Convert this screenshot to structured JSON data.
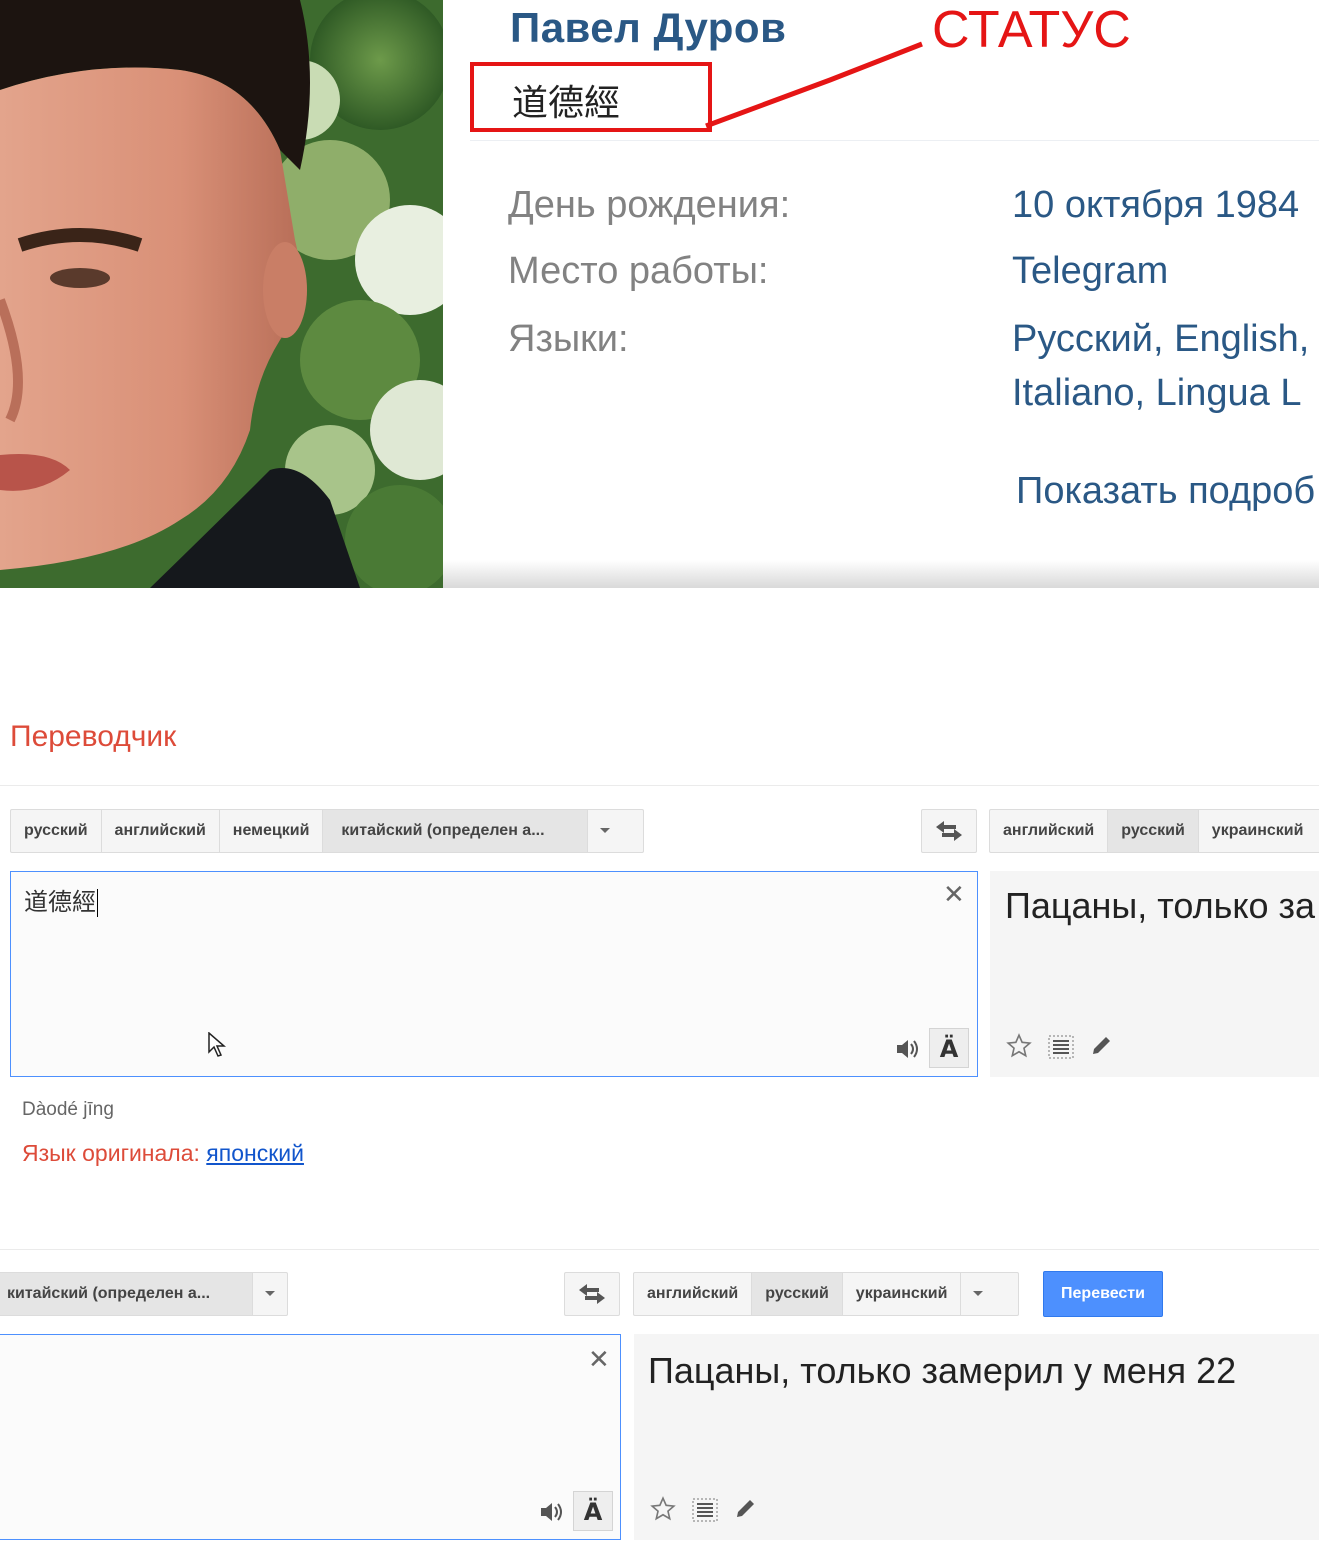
{
  "profile": {
    "name": "Павел Дуров",
    "status": "道德經",
    "annotation_label": "СТАТУС",
    "annotation_color": "#e51515",
    "link_color": "#2a5885",
    "info": [
      {
        "label": "День рождения:",
        "value": "10 октября 1984"
      },
      {
        "label": "Место работы:",
        "value": "Telegram"
      },
      {
        "label": "Языки:",
        "value": "Русский, English,"
      },
      {
        "label": "",
        "value": "Italiano, Lingua L"
      }
    ],
    "show_more": "Показать подроб"
  },
  "translator": {
    "title": "Переводчик",
    "title_color": "#dd4b39",
    "panel1": {
      "source_langs": [
        "русский",
        "английский",
        "немецкий",
        "китайский (определен а..."
      ],
      "source_active": 3,
      "target_langs": [
        "английский",
        "русский",
        "украинский"
      ],
      "target_active": 1,
      "input_text": "道德經",
      "output_text": "Пацаны, только за"
    },
    "transliteration": "Dàodé jīng",
    "detected_prefix": "Язык оригинала:",
    "detected_lang": "японский",
    "panel2": {
      "source_lang": "китайский (определен а...",
      "target_langs": [
        "английский",
        "русский",
        "украинский"
      ],
      "target_active": 1,
      "input_text": "",
      "output_text": "Пацаны, только замерил у меня 22",
      "translate_button": "Перевести",
      "button_color": "#4d90fe"
    },
    "icons": [
      "swap-icon",
      "clear-icon",
      "speaker-icon",
      "input-tools-icon",
      "star-icon",
      "list-icon",
      "pencil-icon",
      "mouse-cursor-icon"
    ]
  }
}
